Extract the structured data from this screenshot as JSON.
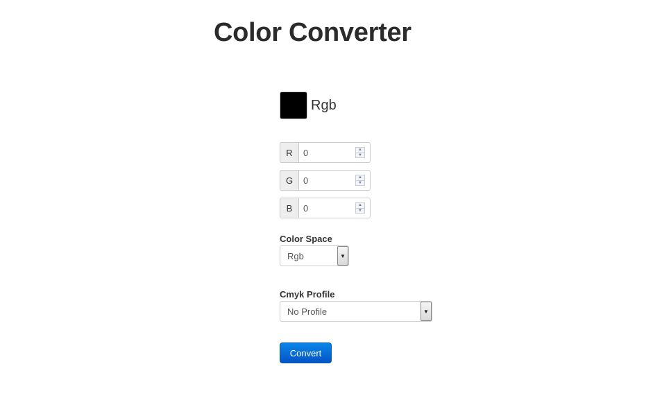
{
  "page": {
    "title": "Color Converter"
  },
  "preview": {
    "swatch_color": "#000000",
    "label": "Rgb"
  },
  "channels": [
    {
      "label": "R",
      "value": "0"
    },
    {
      "label": "G",
      "value": "0"
    },
    {
      "label": "B",
      "value": "0"
    }
  ],
  "color_space": {
    "label": "Color Space",
    "selected": "Rgb"
  },
  "cmyk_profile": {
    "label": "Cmyk Profile",
    "selected": "No Profile"
  },
  "actions": {
    "convert_label": "Convert",
    "accent_color": "#0a6fdc"
  },
  "icons": {
    "spinner_up": "▲",
    "spinner_down": "▼",
    "dropdown": "▼"
  }
}
